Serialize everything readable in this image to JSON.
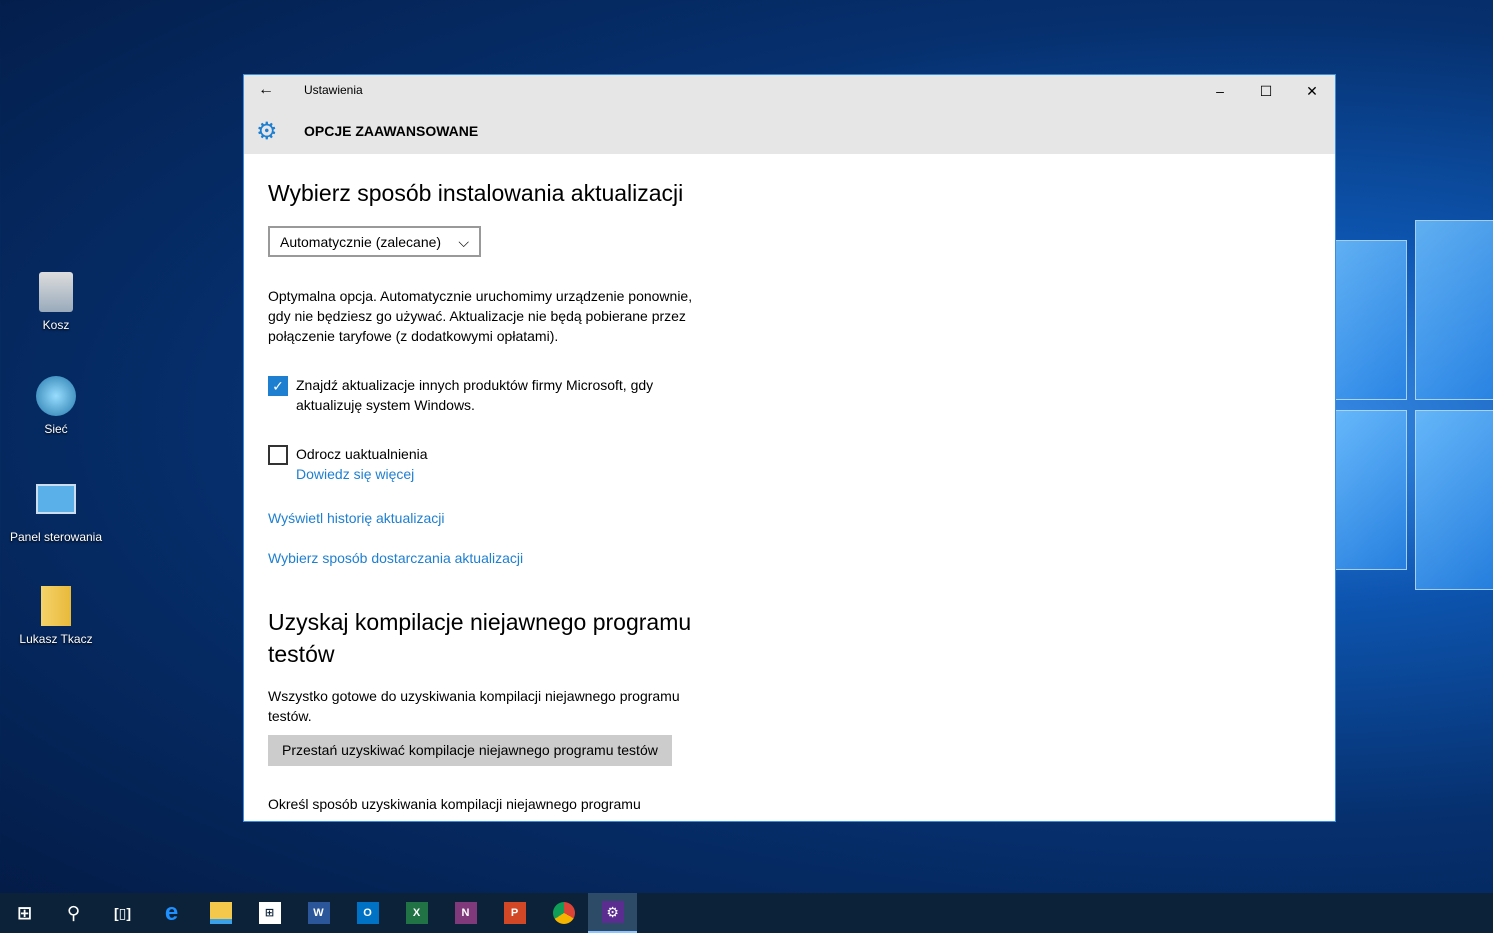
{
  "desktop": {
    "icons": [
      {
        "label": "Kosz",
        "icon": "recycle-bin-icon"
      },
      {
        "label": "Sieć",
        "icon": "network-icon"
      },
      {
        "label": "Panel sterowania",
        "icon": "control-panel-icon"
      },
      {
        "label": "Lukasz Tkacz",
        "icon": "user-folder-icon"
      }
    ]
  },
  "window": {
    "title": "Ustawienia",
    "header": "OPCJE ZAAWANSOWANE",
    "section1": {
      "heading": "Wybierz sposób instalowania aktualizacji",
      "dropdown_value": "Automatycznie (zalecane)",
      "description": "Optymalna opcja. Automatycznie uruchomimy urządzenie ponownie, gdy nie będziesz go używać. Aktualizacje nie będą pobierane przez połączenie taryfowe (z dodatkowymi opłatami).",
      "checkbox_microsoft": {
        "label": "Znajdź aktualizacje innych produktów firmy Microsoft, gdy aktualizuję system Windows.",
        "checked": true
      },
      "checkbox_defer": {
        "label": "Odrocz uaktualnienia",
        "checked": false
      },
      "learn_more": "Dowiedz się więcej",
      "history_link": "Wyświetl historię aktualizacji",
      "delivery_link": "Wybierz sposób dostarczania aktualizacji"
    },
    "section2": {
      "heading": "Uzyskaj kompilacje niejawnego programu testów",
      "status": "Wszystko gotowe do uzyskiwania kompilacji niejawnego programu testów.",
      "stop_button": "Przestań uzyskiwać kompilacje niejawnego programu testów",
      "choose_text": "Określ sposób uzyskiwania kompilacji niejawnego programu"
    }
  },
  "taskbar": {
    "items": [
      "start",
      "search",
      "task-view",
      "edge",
      "file-explorer",
      "store",
      "word",
      "outlook",
      "excel",
      "onenote",
      "powerpoint",
      "chrome",
      "settings"
    ],
    "active": "settings"
  },
  "colors": {
    "accent": "#1e7fd0",
    "taskbar": "#0b2238"
  }
}
